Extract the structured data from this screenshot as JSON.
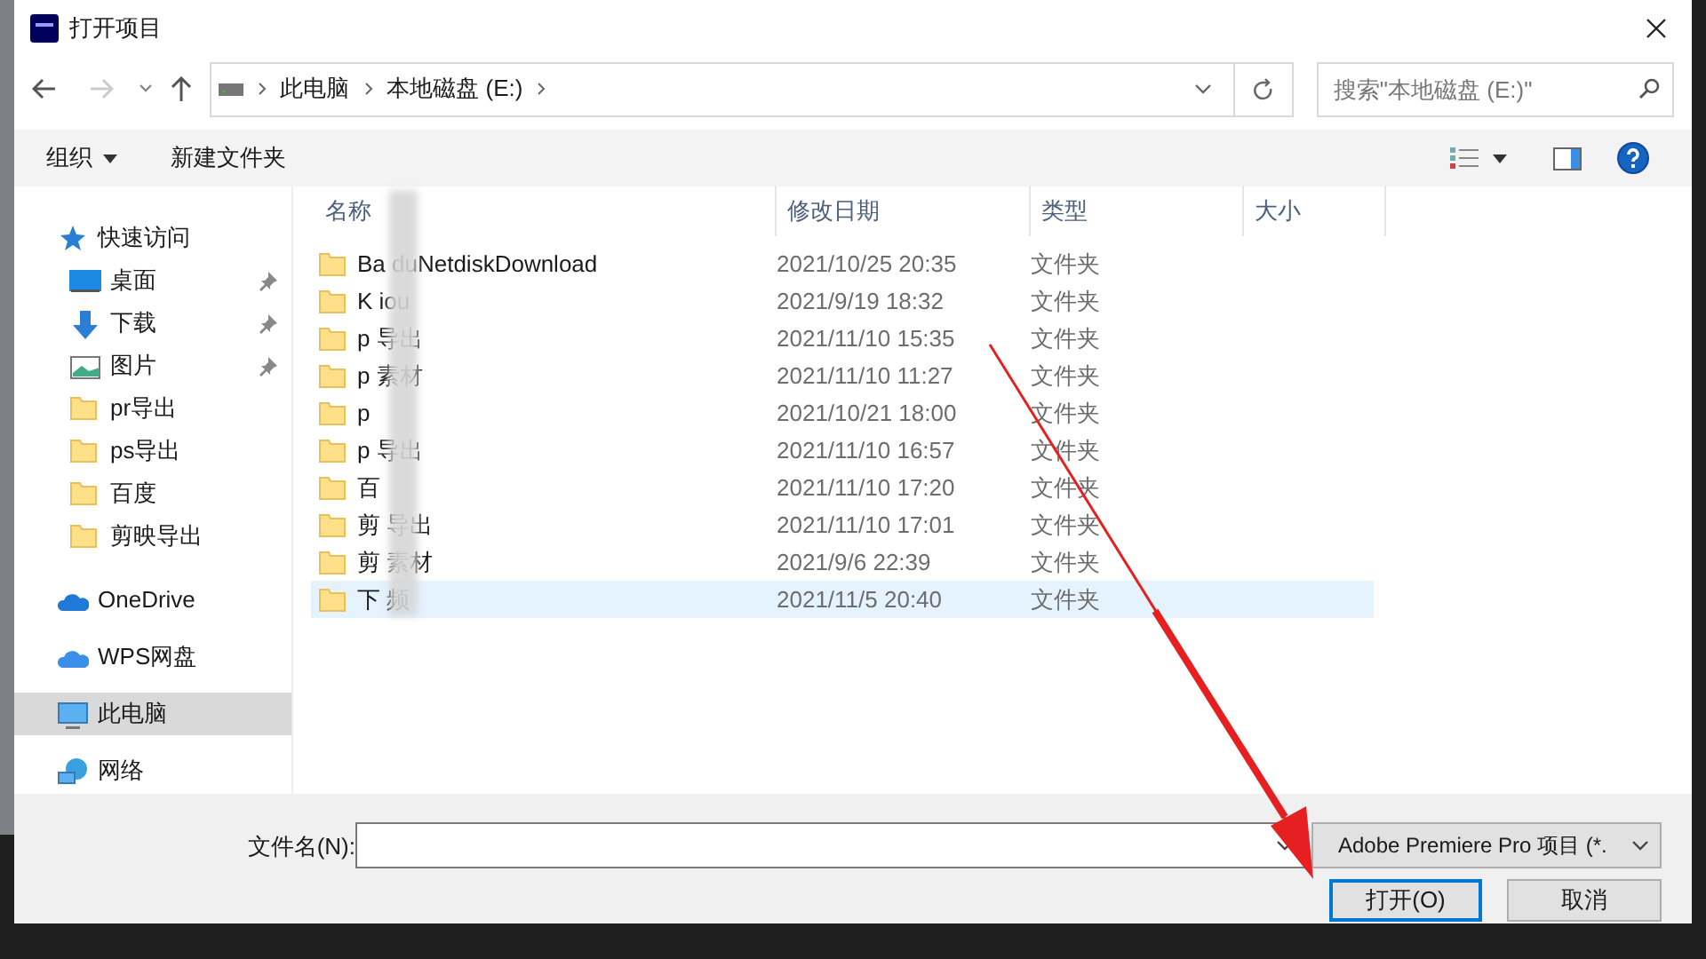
{
  "window": {
    "title": "打开项目"
  },
  "address": {
    "crumbs": [
      "此电脑",
      "本地磁盘 (E:)"
    ],
    "search_placeholder": "搜索\"本地磁盘 (E:)\""
  },
  "toolbar": {
    "organize": "组织",
    "new_folder": "新建文件夹"
  },
  "sidebar": {
    "items": [
      {
        "kind": "star",
        "label": "快速访问",
        "pinned": false,
        "selected": false
      },
      {
        "kind": "desktop",
        "label": "桌面",
        "pinned": true,
        "selected": false
      },
      {
        "kind": "download",
        "label": "下载",
        "pinned": true,
        "selected": false
      },
      {
        "kind": "pictures",
        "label": "图片",
        "pinned": true,
        "selected": false
      },
      {
        "kind": "folder",
        "label": "pr导出",
        "pinned": false,
        "selected": false
      },
      {
        "kind": "folder",
        "label": "ps导出",
        "pinned": false,
        "selected": false
      },
      {
        "kind": "folder",
        "label": "百度",
        "pinned": false,
        "selected": false
      },
      {
        "kind": "folder",
        "label": "剪映导出",
        "pinned": false,
        "selected": false
      },
      {
        "kind": "onedrive",
        "label": "OneDrive",
        "pinned": false,
        "selected": false
      },
      {
        "kind": "cloud",
        "label": "WPS网盘",
        "pinned": false,
        "selected": false
      },
      {
        "kind": "pc",
        "label": "此电脑",
        "pinned": false,
        "selected": true
      },
      {
        "kind": "network",
        "label": "网络",
        "pinned": false,
        "selected": false
      }
    ]
  },
  "table": {
    "columns": [
      "名称",
      "修改日期",
      "类型",
      "大小"
    ],
    "rows": [
      {
        "name": "Ba duNetdiskDownload",
        "modified": "2021/10/25 20:35",
        "type": "文件夹",
        "selected": false
      },
      {
        "name": "K iou",
        "modified": "2021/9/19 18:32",
        "type": "文件夹",
        "selected": false
      },
      {
        "name": "p 导出",
        "modified": "2021/11/10 15:35",
        "type": "文件夹",
        "selected": false
      },
      {
        "name": "p 素材",
        "modified": "2021/11/10 11:27",
        "type": "文件夹",
        "selected": false
      },
      {
        "name": "p",
        "modified": "2021/10/21 18:00",
        "type": "文件夹",
        "selected": false
      },
      {
        "name": "p 导出",
        "modified": "2021/11/10 16:57",
        "type": "文件夹",
        "selected": false
      },
      {
        "name": "百",
        "modified": "2021/11/10 17:20",
        "type": "文件夹",
        "selected": false
      },
      {
        "name": "剪 导出",
        "modified": "2021/11/10 17:01",
        "type": "文件夹",
        "selected": false
      },
      {
        "name": "剪 素材",
        "modified": "2021/9/6 22:39",
        "type": "文件夹",
        "selected": false
      },
      {
        "name": "下 频",
        "modified": "2021/11/5 20:40",
        "type": "文件夹",
        "selected": true
      }
    ]
  },
  "footer": {
    "filename_label": "文件名(N):",
    "filter": "Adobe Premiere Pro 项目 (*.",
    "open_button": "打开(O)",
    "cancel_button": "取消"
  }
}
